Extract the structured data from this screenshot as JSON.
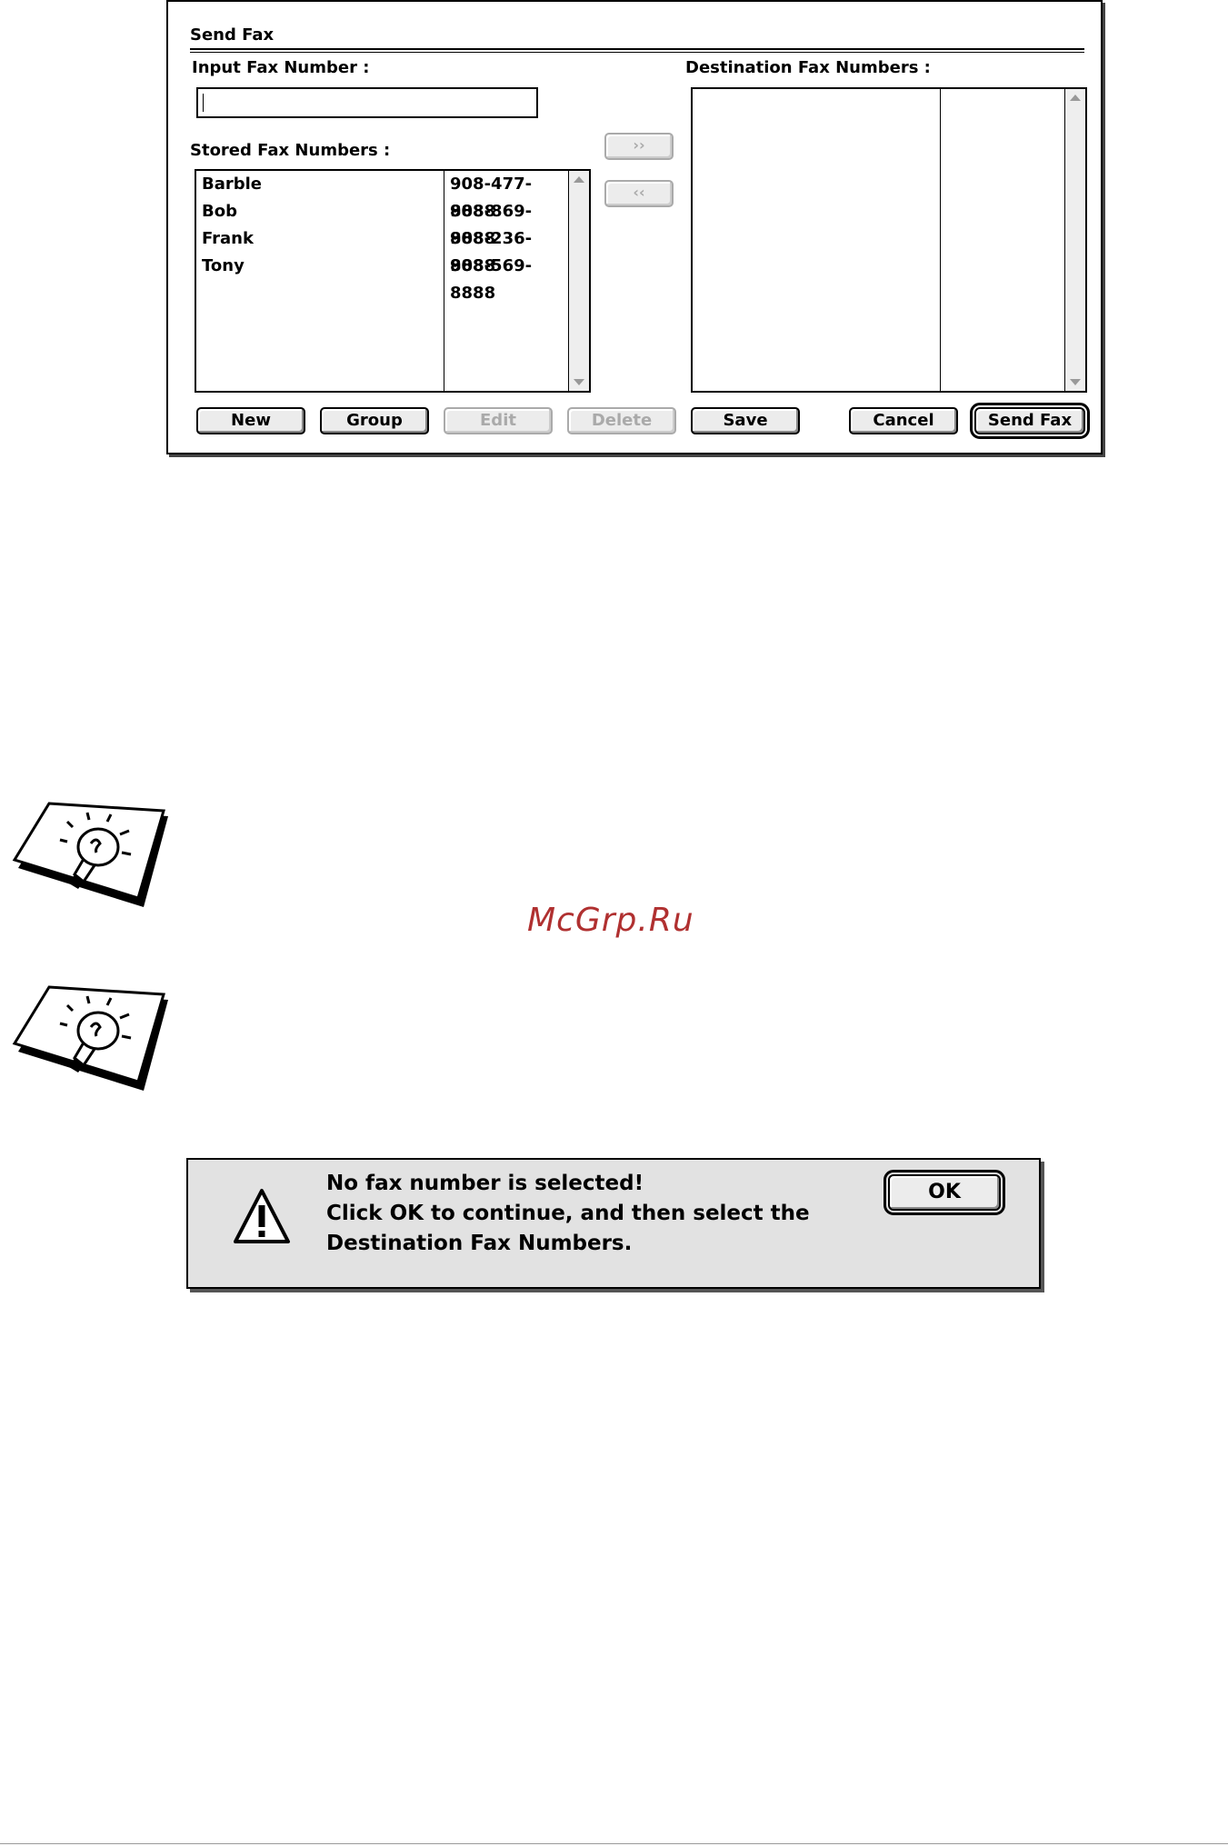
{
  "send_fax": {
    "title": "Send Fax",
    "input_label": "Input Fax Number :",
    "input_value": "",
    "stored_label": "Stored Fax Numbers :",
    "destination_label": "Destination Fax Numbers :",
    "add_arrow": "››",
    "remove_arrow": "‹‹",
    "stored": [
      {
        "name": "Barble",
        "number": "908-477-8888"
      },
      {
        "name": "Bob",
        "number": "908-869-8888"
      },
      {
        "name": "Frank",
        "number": "908-236-8888"
      },
      {
        "name": "Tony",
        "number": "908-569-8888"
      }
    ],
    "buttons": {
      "new": "New",
      "group": "Group",
      "edit": "Edit",
      "delete": "Delete",
      "save": "Save",
      "cancel": "Cancel",
      "send": "Send Fax"
    }
  },
  "watermark": "McGrp.Ru",
  "alert": {
    "line1": "No fax number is selected!",
    "line2": "Click OK to continue, and then select the",
    "line3": "Destination Fax Numbers.",
    "ok": "OK"
  },
  "icons": {
    "tip_1": "lightbulb-note-icon",
    "tip_2": "lightbulb-note-icon",
    "alert": "warning-triangle-icon"
  },
  "colors": {
    "watermark": "#b03030",
    "alert_bg": "#e2e2e2",
    "disabled_text": "#aaaaaa"
  }
}
